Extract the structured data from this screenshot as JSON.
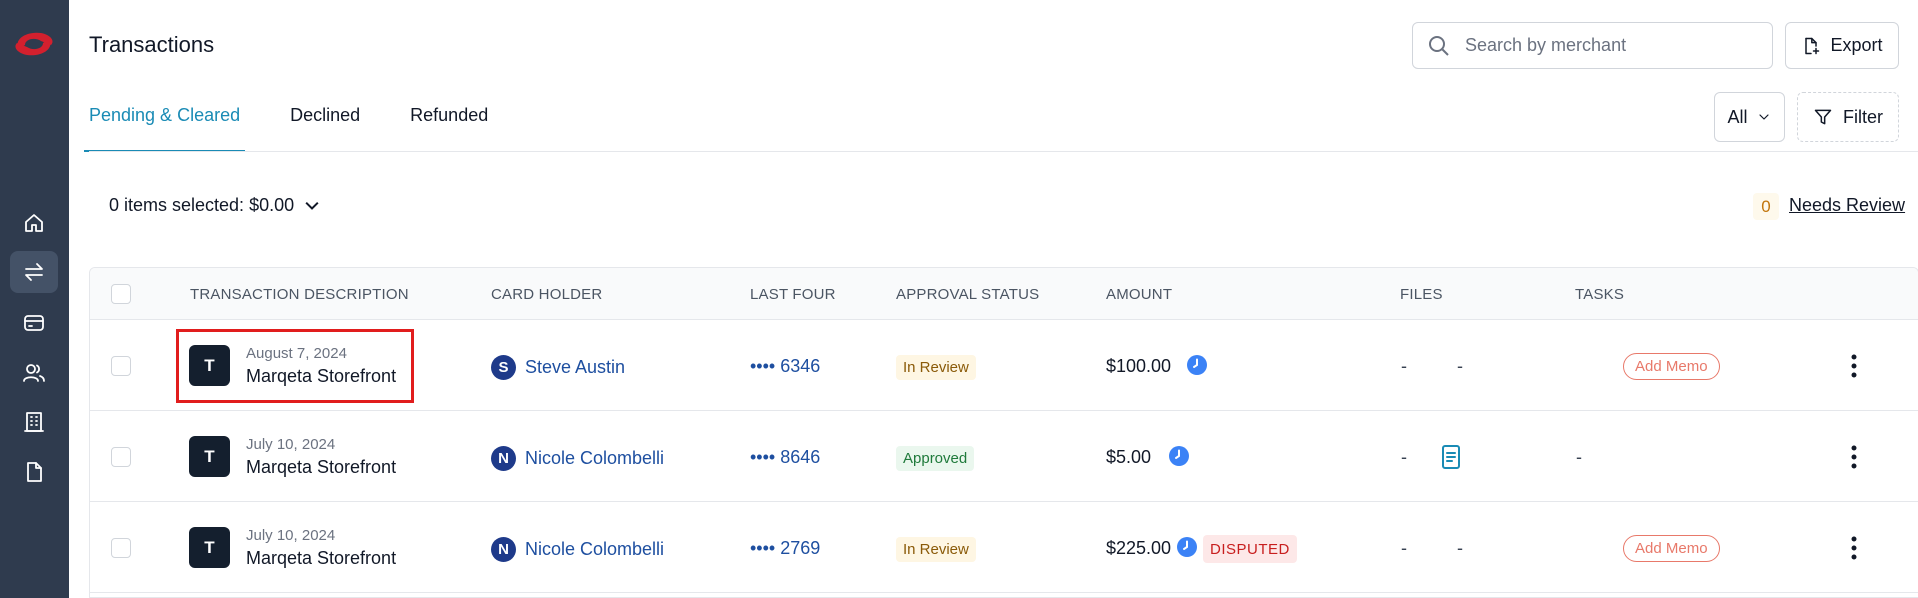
{
  "sidebar": {
    "items": [
      {
        "icon": "home-icon"
      },
      {
        "icon": "transfer-icon",
        "active": true
      },
      {
        "icon": "card-icon"
      },
      {
        "icon": "users-icon"
      },
      {
        "icon": "building-icon"
      },
      {
        "icon": "document-icon"
      }
    ]
  },
  "header": {
    "title": "Transactions",
    "search_placeholder": "Search by merchant",
    "export_label": "Export"
  },
  "tabs": [
    {
      "label": "Pending & Cleared",
      "active": true
    },
    {
      "label": "Declined"
    },
    {
      "label": "Refunded"
    }
  ],
  "filters": {
    "all_label": "All",
    "filter_label": "Filter"
  },
  "selection": {
    "label": "0 items selected: $0.00"
  },
  "review": {
    "count": "0",
    "label": "Needs Review"
  },
  "table": {
    "columns": [
      "TRANSACTION DESCRIPTION",
      "CARD HOLDER",
      "LAST FOUR",
      "APPROVAL STATUS",
      "AMOUNT",
      "FILES",
      "TASKS"
    ],
    "rows": [
      {
        "avatar": "T",
        "date": "August 7, 2024",
        "merchant": "Marqeta Storefront",
        "holder_initial": "S",
        "holder": "Steve Austin",
        "last_four": "•••• 6346",
        "status": "In Review",
        "amount": "$100.00",
        "files_a": "-",
        "files_b": "-",
        "task": "Add Memo"
      },
      {
        "avatar": "T",
        "date": "July 10, 2024",
        "merchant": "Marqeta Storefront",
        "holder_initial": "N",
        "holder": "Nicole Colombelli",
        "last_four": "•••• 8646",
        "status": "Approved",
        "amount": "$5.00",
        "files_a": "-",
        "task": "-"
      },
      {
        "avatar": "T",
        "date": "July 10, 2024",
        "merchant": "Marqeta Storefront",
        "holder_initial": "N",
        "holder": "Nicole Colombelli",
        "last_four": "•••• 2769",
        "status": "In Review",
        "amount": "$225.00",
        "badge": "DISPUTED",
        "files_a": "-",
        "files_b": "-",
        "task": "Add Memo"
      }
    ]
  },
  "colors": {
    "sidebar": "#2f3b4e",
    "accent": "#1a8bb5",
    "link": "#1e4fa0",
    "highlight": "#e11d1d"
  }
}
